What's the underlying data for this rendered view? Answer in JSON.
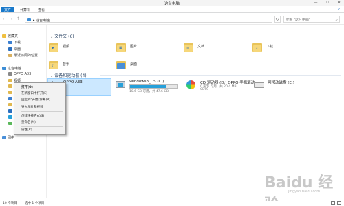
{
  "window": {
    "title": "这台电脑",
    "controls": [
      "—",
      "☐",
      "✕"
    ]
  },
  "ribbon": {
    "tabs": [
      "文件",
      "计算机",
      "查看"
    ],
    "active_tab": "文件",
    "help": "?"
  },
  "address": {
    "crumb": "▸ 这台电脑",
    "back": "←",
    "forward": "→",
    "up": "↑",
    "refresh": "↻",
    "search_placeholder": "搜索 \"这台电脑\""
  },
  "nav": {
    "favorites": "收藏夹",
    "fav_items": [
      "下载",
      "桌面",
      "最近访问的位置"
    ],
    "thispc": "这台电脑",
    "pc_items": [
      "OPPO A33",
      "视频"
    ],
    "network": "网络"
  },
  "content": {
    "folders_header": "文件夹 (6)",
    "folders": [
      "视频",
      "图片",
      "文档",
      "下载",
      "音乐",
      "桌面"
    ],
    "devices_header": "设备和驱动器 (4)",
    "device_oppo": "OPPO A33",
    "drive_c": {
      "name": "Windows8_OS (C:)",
      "free": "10.6 GB 可用，共 47.6 GB",
      "usage": 0.78
    },
    "drive_d": {
      "name": "CD 驱动器 (D:) OPPO 手机驱动",
      "free": "0 字节 可用，共 20.4 MB",
      "fs": "CDFS"
    },
    "drive_e": {
      "name": "可移动磁盘 (E:)"
    }
  },
  "context_menu": {
    "items": [
      "打开(O)",
      "在新窗口中打开(E)",
      "固定到\"开始\"屏幕(P)",
      "导入图片和视频",
      "创建快捷方式(S)",
      "重命名(M)",
      "属性(R)"
    ]
  },
  "status": {
    "count": "10 个项目",
    "selected": "选中 1 个项目"
  },
  "watermark": {
    "brand": "Baidu 经验",
    "url": "jingyan.baidu.com"
  }
}
